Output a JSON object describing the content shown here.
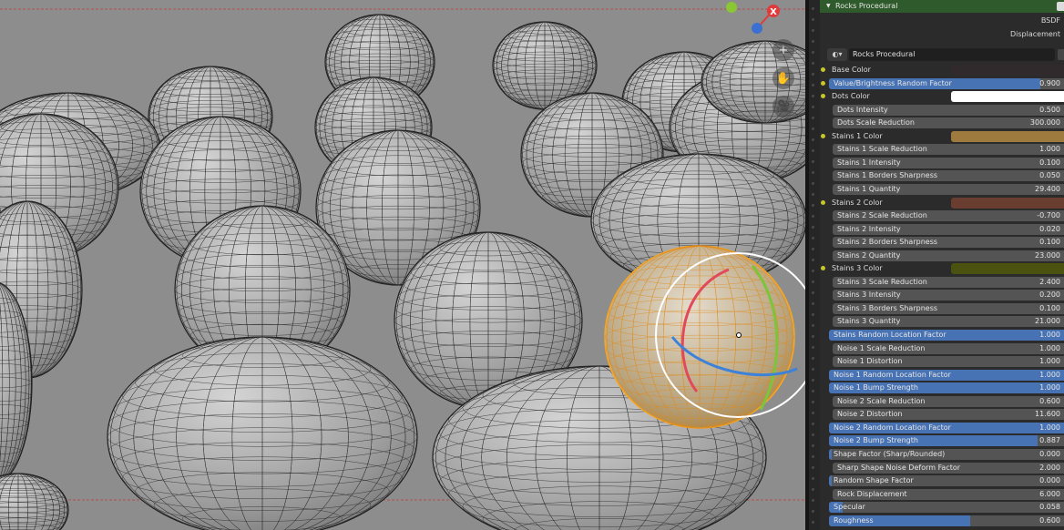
{
  "node": {
    "title": "Rocks Procedural",
    "outputs": [
      "BSDF",
      "Displacement"
    ],
    "material_name": "Rocks Procedural",
    "material_icon": "sphere-material-icon"
  },
  "viewport": {
    "gizmo_axis_label": "X",
    "gizmo_colors": {
      "x": "#e03a3a",
      "y": "#8ac732",
      "z": "#3b6fd1"
    },
    "selection_color": "#f5a623",
    "buttons": [
      "zoom-icon",
      "hand-pan-icon",
      "camera-icon"
    ],
    "zoom_glyph": "+",
    "pan_glyph": "✋",
    "camera_glyph": "🎥"
  },
  "properties": [
    {
      "label": "Base Color",
      "kind": "color",
      "color": "#302a2c",
      "socket": true
    },
    {
      "label": "Value/Brightness Random Factor",
      "kind": "slider",
      "value": "0.900",
      "fraction": 0.9,
      "socket": true
    },
    {
      "label": "Dots Color",
      "kind": "color",
      "color": "#ffffff",
      "socket": true
    },
    {
      "label": "Dots Intensity",
      "kind": "number",
      "value": "0.500",
      "sub": true
    },
    {
      "label": "Dots Scale Reduction",
      "kind": "number",
      "value": "300.000",
      "sub": true
    },
    {
      "label": "Stains 1 Color",
      "kind": "color",
      "color": "#9e7a3e",
      "socket": true
    },
    {
      "label": "Stains 1 Scale Reduction",
      "kind": "number",
      "value": "1.000",
      "sub": true
    },
    {
      "label": "Stains 1 Intensity",
      "kind": "number",
      "value": "0.100",
      "sub": true
    },
    {
      "label": "Stains 1 Borders Sharpness",
      "kind": "number",
      "value": "0.050",
      "sub": true
    },
    {
      "label": "Stains 1 Quantity",
      "kind": "number",
      "value": "29.400",
      "sub": true
    },
    {
      "label": "Stains 2 Color",
      "kind": "color",
      "color": "#6a3d31",
      "socket": true
    },
    {
      "label": "Stains 2 Scale Reduction",
      "kind": "number",
      "value": "-0.700",
      "sub": true
    },
    {
      "label": "Stains 2 Intensity",
      "kind": "number",
      "value": "0.020",
      "sub": true
    },
    {
      "label": "Stains 2 Borders Sharpness",
      "kind": "number",
      "value": "0.100",
      "sub": true
    },
    {
      "label": "Stains 2 Quantity",
      "kind": "number",
      "value": "23.000",
      "sub": true
    },
    {
      "label": "Stains 3 Color",
      "kind": "color",
      "color": "#4b510e",
      "socket": true
    },
    {
      "label": "Stains 3 Scale Reduction",
      "kind": "number",
      "value": "2.400",
      "sub": true
    },
    {
      "label": "Stains 3 Intensity",
      "kind": "number",
      "value": "0.200",
      "sub": true
    },
    {
      "label": "Stains 3 Borders Sharpness",
      "kind": "number",
      "value": "0.100",
      "sub": true
    },
    {
      "label": "Stains 3 Quantity",
      "kind": "number",
      "value": "21.000",
      "sub": true
    },
    {
      "label": "Stains Random Location Factor",
      "kind": "slider",
      "value": "1.000",
      "fraction": 1.0
    },
    {
      "label": "Noise 1 Scale Reduction",
      "kind": "number",
      "value": "1.000",
      "sub": true
    },
    {
      "label": "Noise 1 Distortion",
      "kind": "number",
      "value": "1.000",
      "sub": true
    },
    {
      "label": "Noise 1 Random Location Factor",
      "kind": "slider",
      "value": "1.000",
      "fraction": 1.0
    },
    {
      "label": "Noise 1 Bump Strength",
      "kind": "slider",
      "value": "1.000",
      "fraction": 1.0
    },
    {
      "label": "Noise 2 Scale Reduction",
      "kind": "number",
      "value": "0.600",
      "sub": true
    },
    {
      "label": "Noise 2 Distortion",
      "kind": "number",
      "value": "11.600",
      "sub": true
    },
    {
      "label": "Noise 2 Random Location Factor",
      "kind": "slider",
      "value": "1.000",
      "fraction": 1.0
    },
    {
      "label": "Noise 2 Bump Strength",
      "kind": "slider",
      "value": "0.887",
      "fraction": 0.887
    },
    {
      "label": "Shape Factor (Sharp/Rounded)",
      "kind": "slider",
      "value": "0.000",
      "fraction": 0.0
    },
    {
      "label": "Sharp Shape Noise Deform Factor",
      "kind": "number",
      "value": "2.000",
      "sub": true
    },
    {
      "label": "Random Shape Factor",
      "kind": "slider",
      "value": "0.000",
      "fraction": 0.0
    },
    {
      "label": "Rock Displacement",
      "kind": "number",
      "value": "6.000",
      "sub": true
    },
    {
      "label": "Specular",
      "kind": "slider",
      "value": "0.058",
      "fraction": 0.058
    },
    {
      "label": "Roughness",
      "kind": "slider",
      "value": "0.600",
      "fraction": 0.6
    }
  ]
}
